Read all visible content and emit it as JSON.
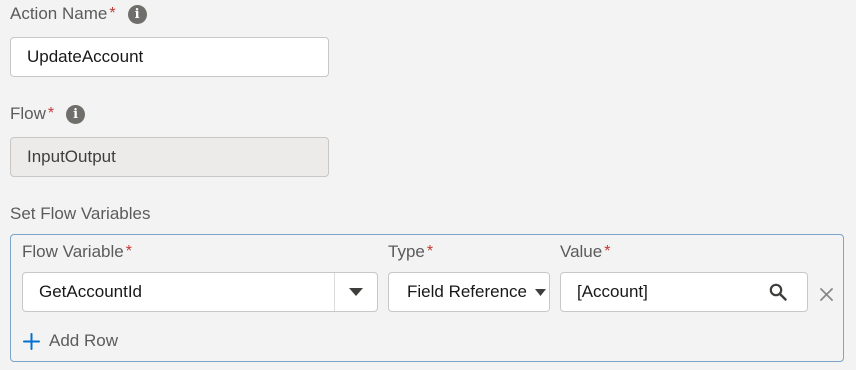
{
  "action_name": {
    "label": "Action Name",
    "required": "*",
    "value": "UpdateAccount",
    "info_icon": "info-icon"
  },
  "flow": {
    "label": "Flow",
    "required": "*",
    "value": "InputOutput",
    "info_icon": "info-icon"
  },
  "set_flow_variables": {
    "label": "Set Flow Variables",
    "columns": {
      "flow_variable": "Flow Variable",
      "type": "Type",
      "value": "Value",
      "required": "*"
    },
    "rows": [
      {
        "flow_variable": "GetAccountId",
        "type": "Field Reference",
        "value": "[Account]"
      }
    ],
    "add_row_label": "Add Row"
  },
  "icons": {
    "dropdown": "chevron-down-icon",
    "search": "search-icon",
    "remove": "close-icon",
    "add": "plus-icon"
  },
  "colors": {
    "accent": "#0070d2",
    "required": "#c23934",
    "panel_border": "#7ca3c8"
  }
}
